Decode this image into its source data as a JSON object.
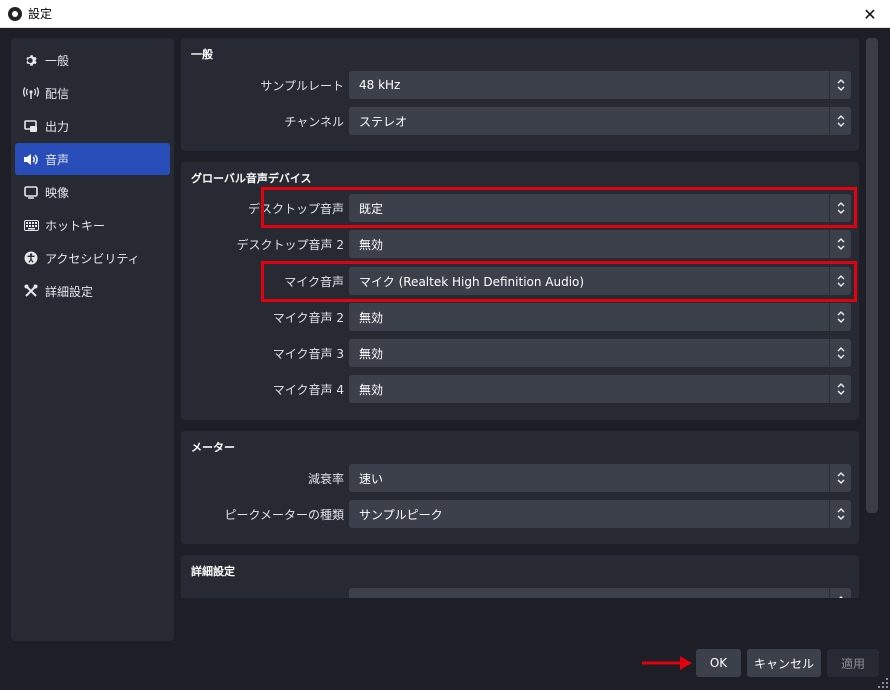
{
  "window": {
    "title": "設定",
    "close_glyph": "✕"
  },
  "sidebar": {
    "items": [
      {
        "label": "一般",
        "icon": "gear-icon",
        "glyph": "⚙"
      },
      {
        "label": "配信",
        "icon": "antenna-icon",
        "glyph": "((·))"
      },
      {
        "label": "出力",
        "icon": "output-icon",
        "glyph": "▣"
      },
      {
        "label": "音声",
        "icon": "speaker-icon",
        "glyph": "🔊"
      },
      {
        "label": "映像",
        "icon": "monitor-icon",
        "glyph": "▭"
      },
      {
        "label": "ホットキー",
        "icon": "keyboard-icon",
        "glyph": "⌨"
      },
      {
        "label": "アクセシビリティ",
        "icon": "accessibility-icon",
        "glyph": "♿"
      },
      {
        "label": "詳細設定",
        "icon": "tools-icon",
        "glyph": "✕"
      }
    ],
    "active_index": 3
  },
  "sections": {
    "general": {
      "title": "一般",
      "sample_rate": {
        "label": "サンプルレート",
        "value": "48 kHz"
      },
      "channels": {
        "label": "チャンネル",
        "value": "ステレオ"
      }
    },
    "global_devices": {
      "title": "グローバル音声デバイス",
      "desktop_audio": {
        "label": "デスクトップ音声",
        "value": "既定"
      },
      "desktop_audio_2": {
        "label": "デスクトップ音声 2",
        "value": "無効"
      },
      "mic_audio": {
        "label": "マイク音声",
        "value": "マイク (Realtek High Definition Audio)"
      },
      "mic_audio_2": {
        "label": "マイク音声 2",
        "value": "無効"
      },
      "mic_audio_3": {
        "label": "マイク音声 3",
        "value": "無効"
      },
      "mic_audio_4": {
        "label": "マイク音声 4",
        "value": "無効"
      }
    },
    "meters": {
      "title": "メーター",
      "decay_rate": {
        "label": "減衰率",
        "value": "速い"
      },
      "peak_meter_type": {
        "label": "ピークメーターの種類",
        "value": "サンプルピーク"
      }
    },
    "advanced": {
      "title": "詳細設定"
    }
  },
  "buttons": {
    "ok": "OK",
    "cancel": "キャンセル",
    "apply": "適用"
  },
  "colors": {
    "accent": "#284cb8",
    "highlight": "#e3000f",
    "panel": "#272a33",
    "background": "#1e1f26"
  }
}
